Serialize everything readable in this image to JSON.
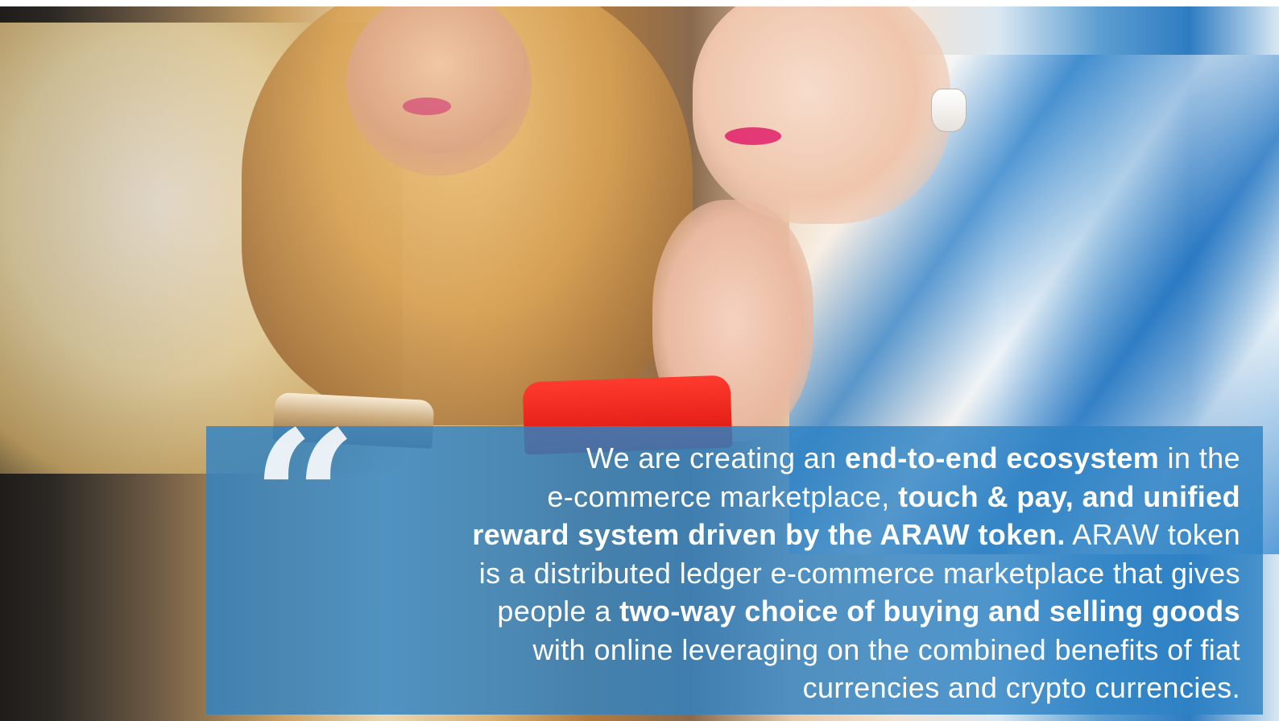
{
  "quote": {
    "mark": "“",
    "lines": [
      [
        {
          "text": "We are creating an ",
          "bold": false
        },
        {
          "text": "end-to-end ecosystem",
          "bold": true
        },
        {
          "text": " in the",
          "bold": false
        }
      ],
      [
        {
          "text": "e-commerce marketplace, ",
          "bold": false
        },
        {
          "text": "touch & pay, and unified",
          "bold": true
        }
      ],
      [
        {
          "text": "reward system driven by the ARAW token.",
          "bold": true
        },
        {
          "text": " ARAW token",
          "bold": false
        }
      ],
      [
        {
          "text": "is a distributed ledger e-commerce marketplace that gives",
          "bold": false
        }
      ],
      [
        {
          "text": "people a ",
          "bold": false
        },
        {
          "text": "two-way choice of buying and selling goods",
          "bold": true
        }
      ],
      [
        {
          "text": "with online leveraging on the combined benefits of fiat",
          "bold": false
        }
      ],
      [
        {
          "text": "currencies and crypto currencies.",
          "bold": false
        }
      ]
    ]
  },
  "colors": {
    "panel": "#2e83c5",
    "text": "#ffffff"
  }
}
